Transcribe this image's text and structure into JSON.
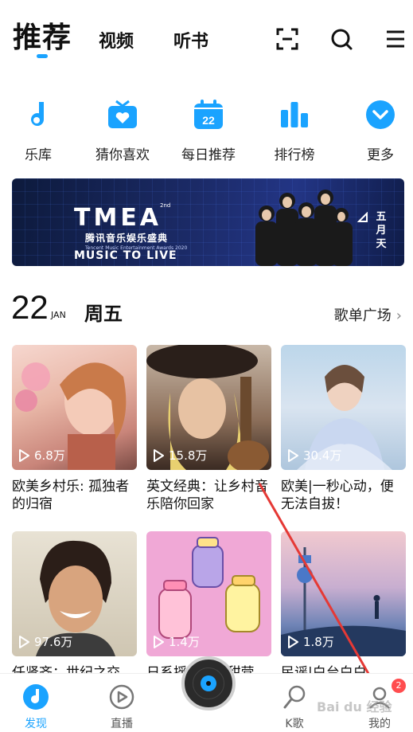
{
  "colors": {
    "accent": "#1aa3ff",
    "text": "#111111",
    "badge": "#ff4d4f",
    "arrow": "#e53935"
  },
  "topnav": {
    "tabs": [
      {
        "label": "推荐",
        "active": true
      },
      {
        "label": "视频",
        "active": false
      },
      {
        "label": "听书",
        "active": false
      }
    ],
    "icons": [
      "scan-icon",
      "search-icon",
      "menu-icon"
    ]
  },
  "entries": [
    {
      "label": "乐库",
      "icon": "music-note-icon"
    },
    {
      "label": "猜你喜欢",
      "icon": "radio-heart-icon"
    },
    {
      "label": "每日推荐",
      "icon": "calendar-icon",
      "icon_text": "22"
    },
    {
      "label": "排行榜",
      "icon": "bar-chart-icon"
    },
    {
      "label": "更多",
      "icon": "chevron-down-icon"
    }
  ],
  "banner": {
    "logo": "TMEA",
    "title_cn": "腾讯音乐娱乐盛典",
    "subtitle": "Tencent Music Entertainment Awards 2020",
    "slogan": "MUSIC TO LIVE",
    "band": "五月天",
    "edition": "2nd"
  },
  "date": {
    "day": "22",
    "month": "JAN",
    "weekday": "周五",
    "more": "歌单广场"
  },
  "playlists": [
    {
      "plays": "6.8万",
      "title": "欧美乡村乐: 孤独者的归宿"
    },
    {
      "plays": "15.8万",
      "title": "英文经典：让乡村音乐陪你回家"
    },
    {
      "plays": "30.4万",
      "title": "欧美|一秒心动，便无法自拔！"
    },
    {
      "plays": "97.6万",
      "title": "任贤齐：世纪之交"
    },
    {
      "plays": "1.4万",
      "title": "日系摇滚 | 酸甜营"
    },
    {
      "plays": "1.8万",
      "title": "民谣|白台白白"
    }
  ],
  "bottombar": {
    "items": [
      {
        "label": "发现",
        "icon": "discover-icon",
        "active": true
      },
      {
        "label": "直播",
        "icon": "live-play-icon",
        "active": false
      },
      {
        "label": "K歌",
        "icon": "karaoke-mic-icon",
        "active": false
      },
      {
        "label": "我的",
        "icon": "profile-icon",
        "active": false
      }
    ],
    "badge": "2"
  },
  "watermark": "Bai du 经验"
}
